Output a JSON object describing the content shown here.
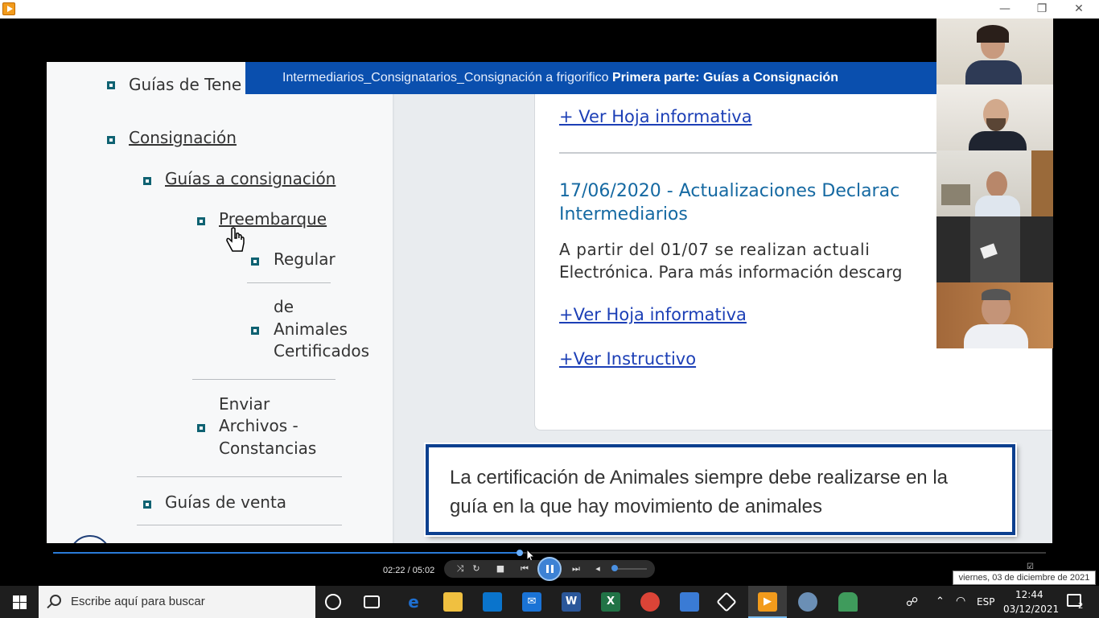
{
  "window": {
    "minimize": "—",
    "restore": "❐",
    "close": "✕"
  },
  "slide": {
    "banner_prefix": "Intermediarios_Consignatarios_Consignación a frigorifico",
    "banner_bold": "Primera parte: Guías a Consignación",
    "nav": {
      "guias_tenencia": "Guías de Tene",
      "consignacion": "Consignación",
      "guias_consignacion": "Guías a consignación",
      "preembarque": "Preembarque",
      "regular": "Regular",
      "animales_cert_1": "de",
      "animales_cert_2": "Animales",
      "animales_cert_3": "Certificados",
      "enviar_1": "Enviar",
      "enviar_2": "Archivos -",
      "enviar_3": "Constancias",
      "guias_venta": "Guías de venta"
    },
    "content": {
      "ver_hoja_1": "+ Ver Hoja informativa",
      "news_title_1": "17/06/2020 - Actualizaciones Declarac",
      "news_title_2": "Intermediarios",
      "news_body_1": "A partir del 01/07 se realizan actuali",
      "news_body_2": "Electrónica. Para más información descarg",
      "ver_hoja_2": "+Ver Hoja informativa",
      "ver_instructivo": "+Ver Instructivo"
    },
    "callout_1": "La certificación de Animales siempre debe realizarse en la",
    "callout_2": "guía en la que hay movimiento de animales"
  },
  "player": {
    "time": "02:22 / 05:02",
    "progress_fraction": 0.47,
    "tooltip": "viernes, 03 de diciembre de 2021"
  },
  "taskbar": {
    "search_placeholder": "Escribe aquí para buscar",
    "language": "ESP",
    "time": "12:44",
    "date": "03/12/2021",
    "notifications": "2",
    "colors": {
      "edge": "#1e6fd0",
      "explorer": "#f0c040",
      "store": "#0a74cc",
      "mail": "#1a73d6",
      "word": "#2b579a",
      "excel": "#217346",
      "chrome": "#db4437"
    }
  }
}
